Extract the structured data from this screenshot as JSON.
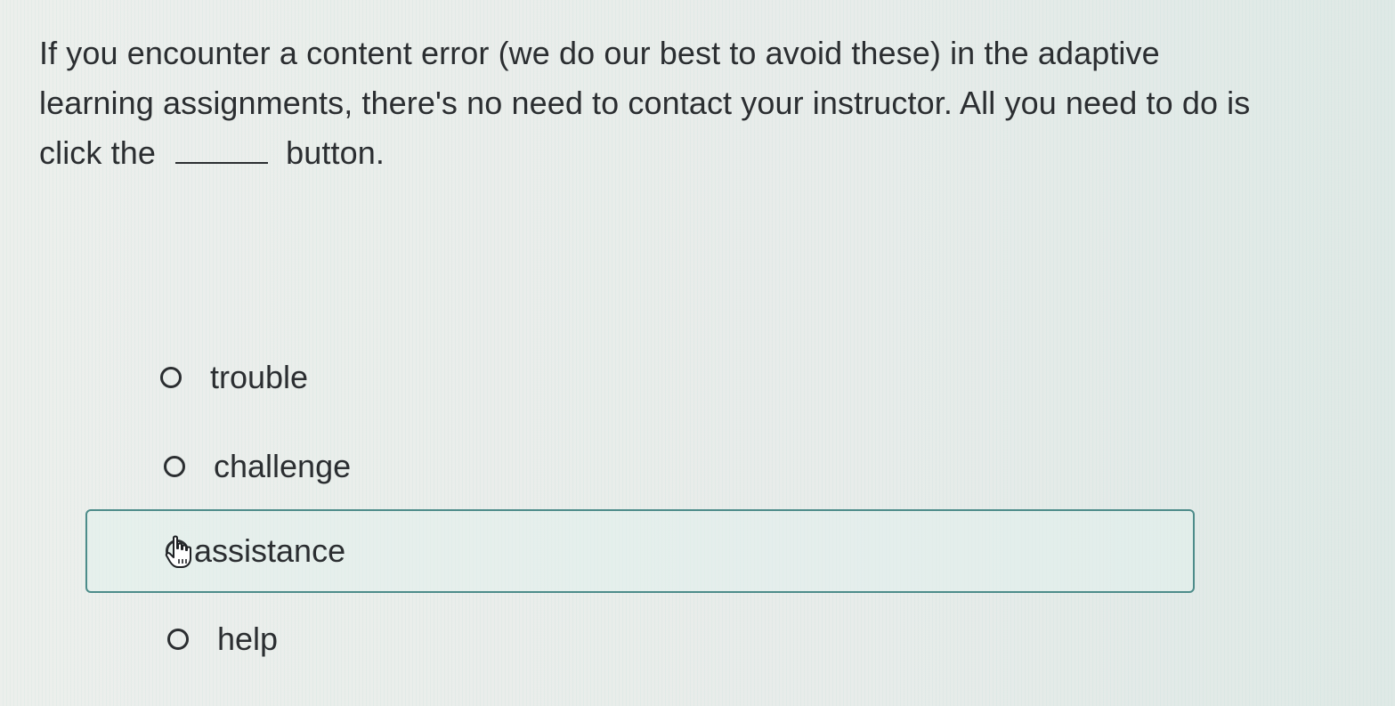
{
  "question": {
    "text_before": "If you encounter a content error (we do our best to avoid these) in the adaptive learning assignments, there's no need to contact your instructor. All you need to do is click the",
    "text_after": "button."
  },
  "options": [
    {
      "label": "trouble",
      "selected": false
    },
    {
      "label": "challenge",
      "selected": false
    },
    {
      "label": "assistance",
      "selected": true
    },
    {
      "label": "help",
      "selected": false
    }
  ],
  "colors": {
    "text": "#2b2e31",
    "highlight_border": "#4d8c8a"
  },
  "icons": {
    "cursor": "hand-pointer-icon"
  }
}
